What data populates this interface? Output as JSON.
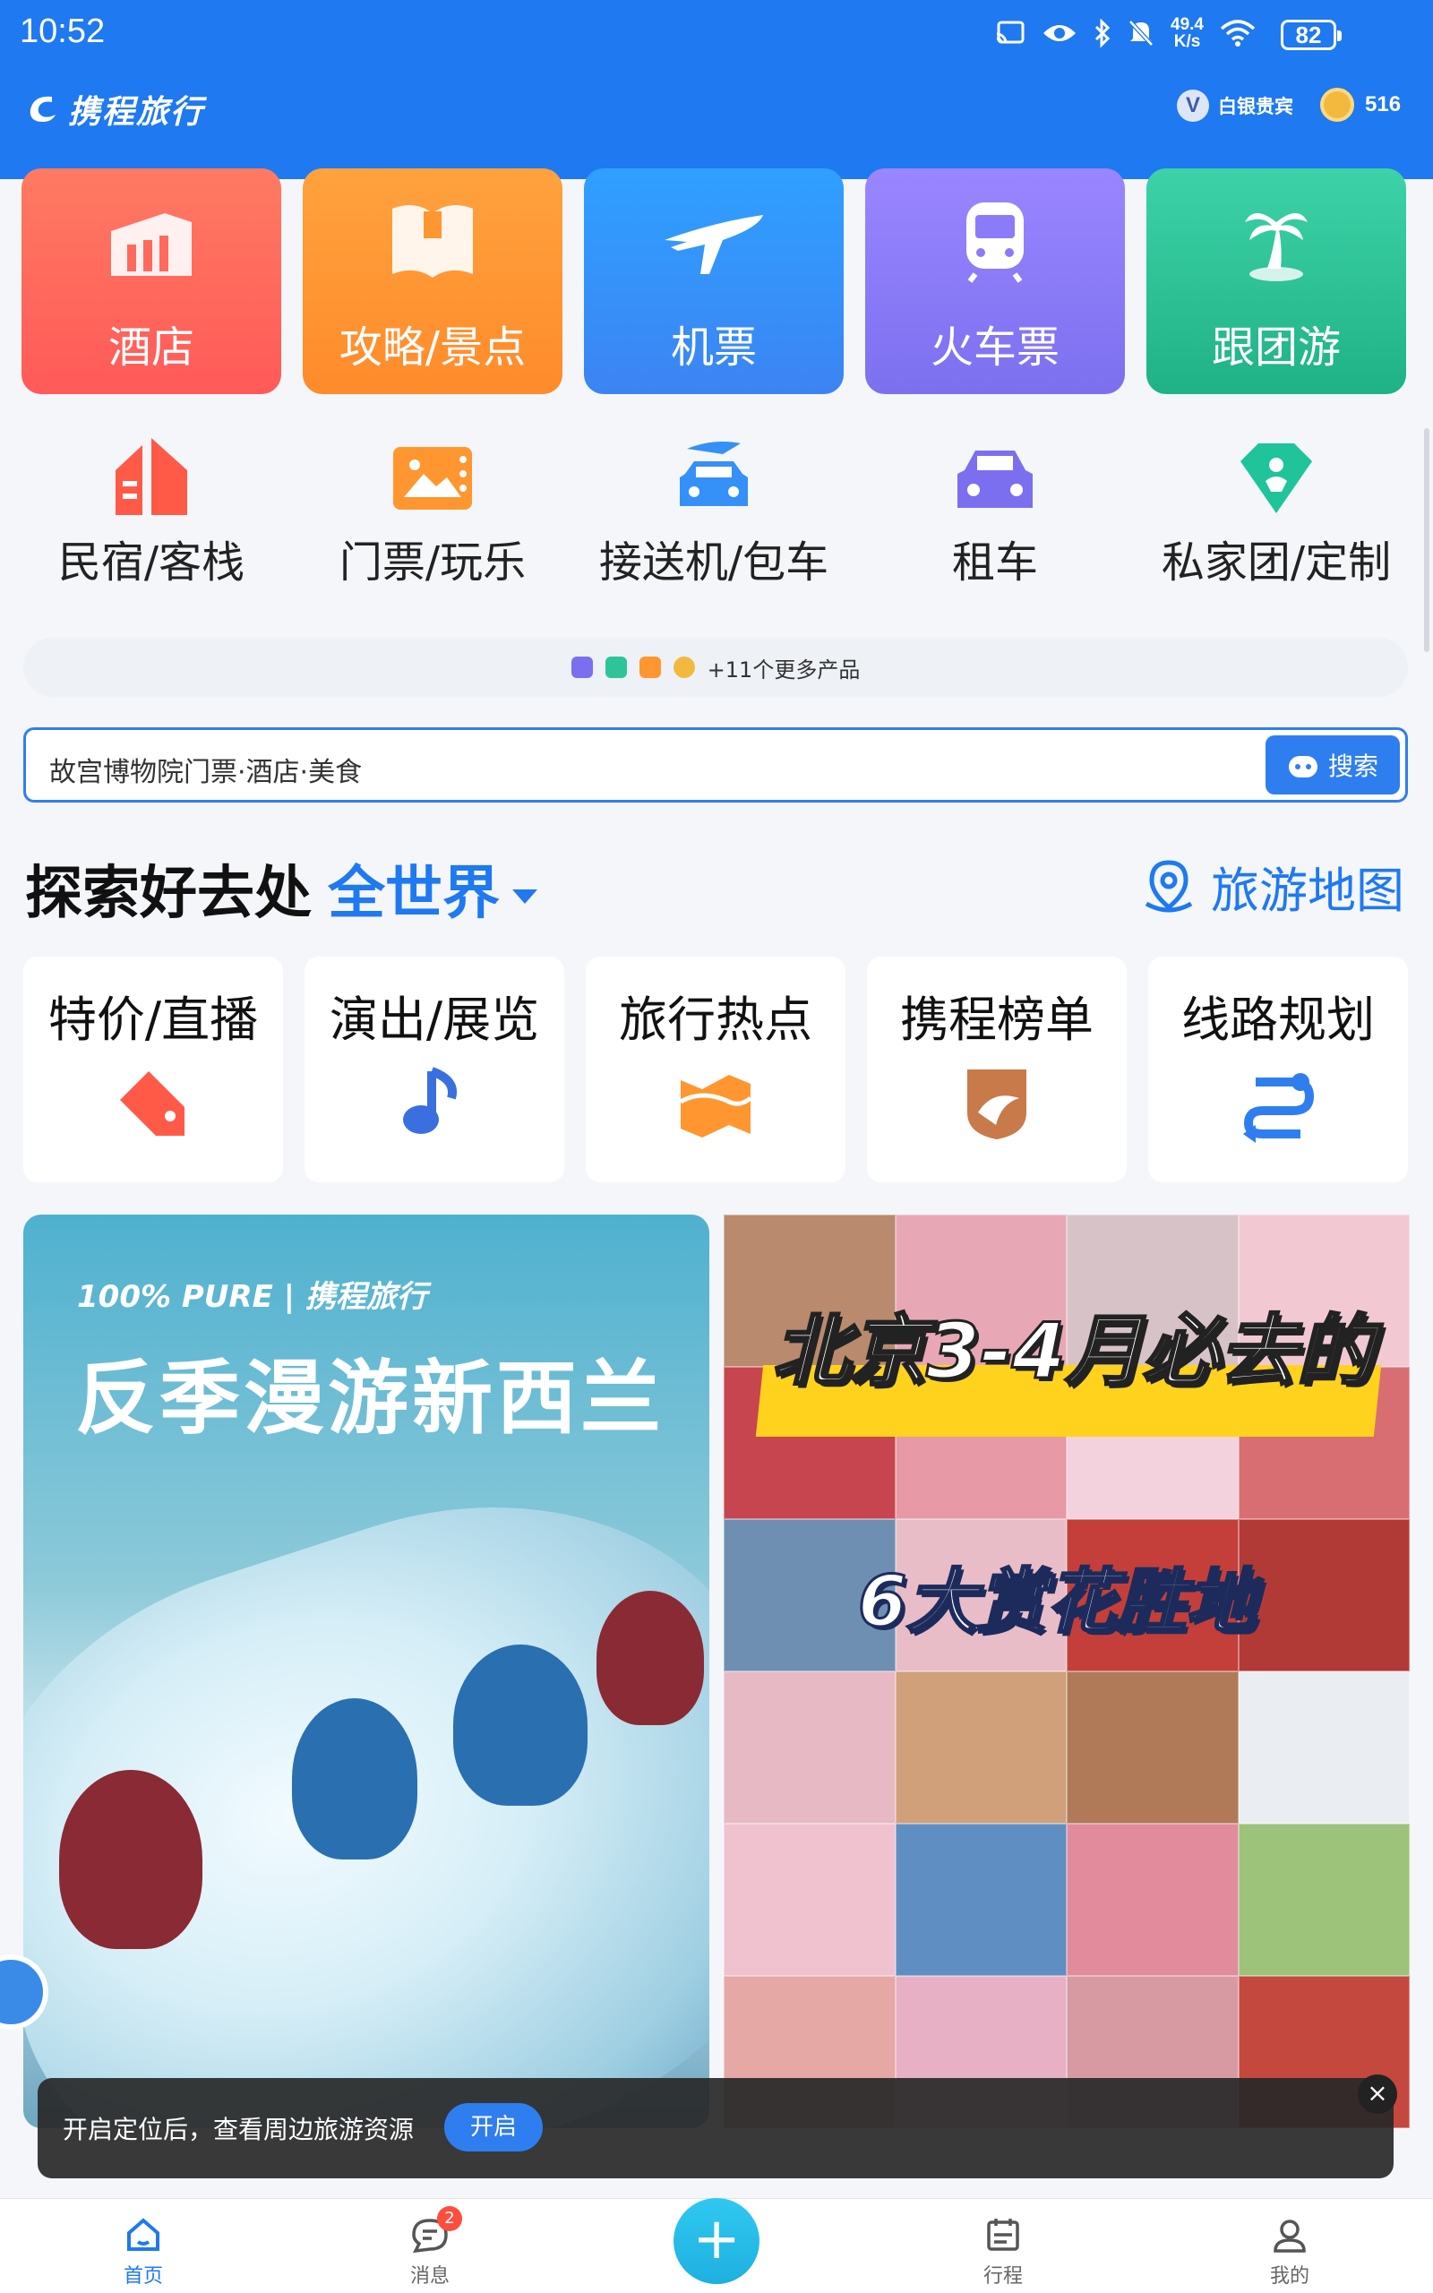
{
  "status": {
    "time": "10:52",
    "net_speed_top": "49.4",
    "net_speed_bottom": "K/s",
    "battery": "82"
  },
  "brand": {
    "logo_text": "携程旅行",
    "member_level": "白银贵宾",
    "coins": "516"
  },
  "main_services": [
    {
      "label": "酒店"
    },
    {
      "label": "攻略/景点"
    },
    {
      "label": "机票"
    },
    {
      "label": "火车票"
    },
    {
      "label": "跟团游"
    }
  ],
  "sub_services": [
    {
      "label": "民宿/客栈"
    },
    {
      "label": "门票/玩乐"
    },
    {
      "label": "接送机/包车"
    },
    {
      "label": "租车"
    },
    {
      "label": "私家团/定制"
    }
  ],
  "more_products": "+11个更多产品",
  "search": {
    "placeholder": "故宫博物院门票·酒店·美食",
    "button": "搜索"
  },
  "explore": {
    "title": "探索好去处",
    "region": "全世界",
    "map_link": "旅游地图"
  },
  "explore_cards": [
    {
      "label": "特价/直播"
    },
    {
      "label": "演出/展览"
    },
    {
      "label": "旅行热点"
    },
    {
      "label": "携程榜单"
    },
    {
      "label": "线路规划"
    }
  ],
  "banners": {
    "left": {
      "top_line": "100% PURE | 携程旅行",
      "headline": "反季漫游新西兰"
    },
    "right": {
      "headline": "北京3-4月必去的",
      "subline": "6大赏花胜地"
    }
  },
  "toast": {
    "message": "开启定位后，查看周边旅游资源",
    "action": "开启"
  },
  "bottom_nav": {
    "home": "首页",
    "messages": "消息",
    "messages_badge": "2",
    "trips": "行程",
    "mine": "我的"
  },
  "colors": {
    "brand_blue": "#1f79f0",
    "hotel": "#ff6a5c",
    "guide": "#ff962f",
    "flight": "#3590f8",
    "train": "#8b7bf8",
    "tour": "#2dc49a"
  }
}
